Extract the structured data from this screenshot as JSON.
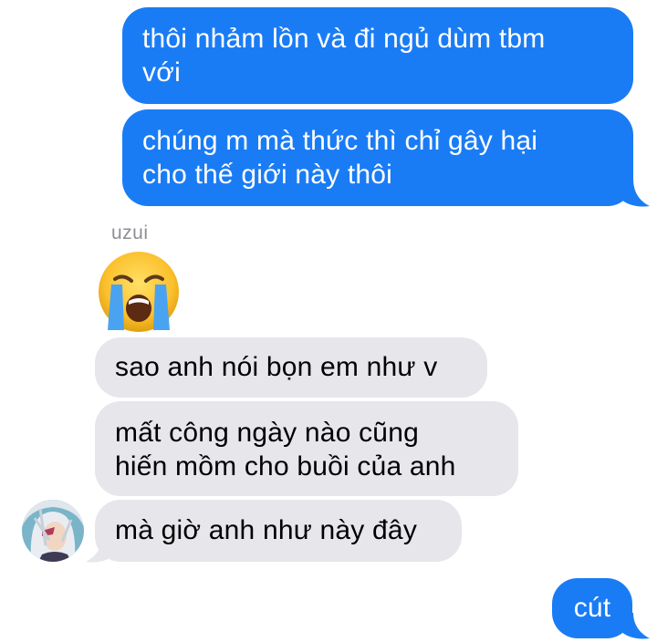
{
  "messages": {
    "out_1": [
      "thôi nhảm lồn và đi ngủ dùm tbm",
      "với"
    ],
    "out_2": [
      "chúng m mà thức thì chỉ gây hại",
      "cho thế giới này thôi"
    ],
    "sender": "uzui",
    "in_1": "sao anh nói bọn em như v",
    "in_2": [
      "mất công ngày nào cũng",
      "hiến mồm cho buồi của anh"
    ],
    "in_3": "mà giờ anh như này đây",
    "out_3": "cút"
  },
  "emoji": "loudly-crying-face-icon",
  "colors": {
    "outgoing": "#1a7cf5",
    "incoming": "#e6e6eb",
    "sender_name": "#8e8e93"
  }
}
